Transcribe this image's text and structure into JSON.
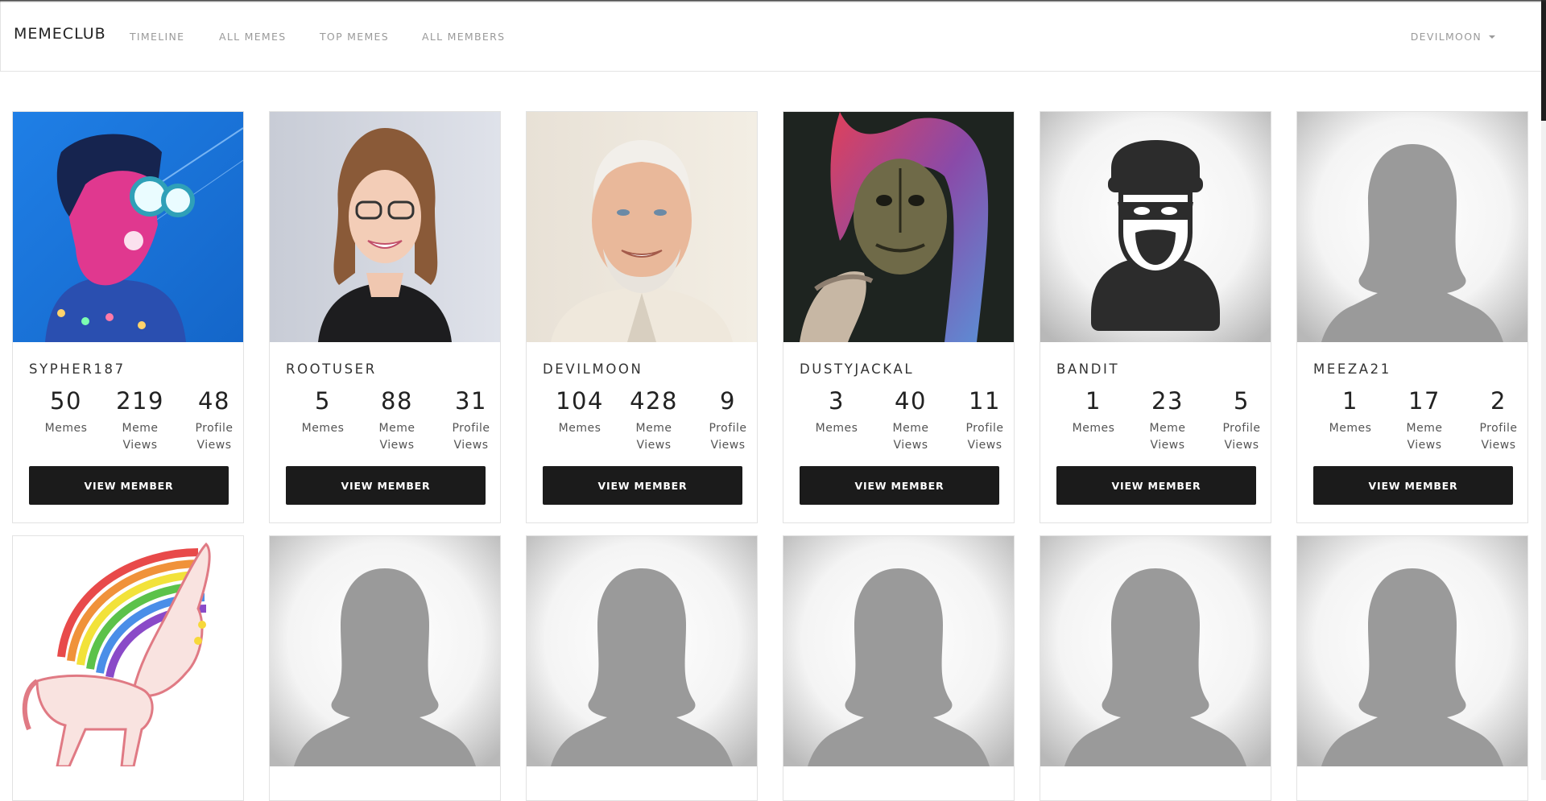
{
  "nav": {
    "brand": "MEMECLUB",
    "links": [
      "TIMELINE",
      "ALL MEMES",
      "TOP MEMES",
      "ALL MEMBERS"
    ],
    "user": "DEVILMOON"
  },
  "labels": {
    "memes": "Memes",
    "meme_views": "Meme Views",
    "profile_views": "Profile Views",
    "button": "VIEW MEMBER"
  },
  "members": [
    {
      "name": "SYPHER187",
      "memes": "50",
      "meme_views": "219",
      "profile_views": "48",
      "avatar": "cyberpunk-art"
    },
    {
      "name": "ROOTUSER",
      "memes": "5",
      "meme_views": "88",
      "profile_views": "31",
      "avatar": "woman-portrait"
    },
    {
      "name": "DEVILMOON",
      "memes": "104",
      "meme_views": "428",
      "profile_views": "9",
      "avatar": "old-man-portrait"
    },
    {
      "name": "DUSTYJACKAL",
      "memes": "3",
      "meme_views": "40",
      "profile_views": "11",
      "avatar": "masked-rocker"
    },
    {
      "name": "BANDIT",
      "memes": "1",
      "meme_views": "23",
      "profile_views": "5",
      "avatar": "bandit-icon"
    },
    {
      "name": "MEEZA21",
      "memes": "1",
      "meme_views": "17",
      "profile_views": "2",
      "avatar": "default-silhouette"
    },
    {
      "avatar": "rainbow-unicorn"
    },
    {
      "avatar": "default-silhouette"
    },
    {
      "avatar": "default-silhouette"
    },
    {
      "avatar": "default-silhouette"
    },
    {
      "avatar": "default-silhouette"
    },
    {
      "avatar": "default-silhouette"
    }
  ],
  "colors": {
    "button_bg": "#1b1b1b",
    "nav_text": "#9a9a9a"
  }
}
